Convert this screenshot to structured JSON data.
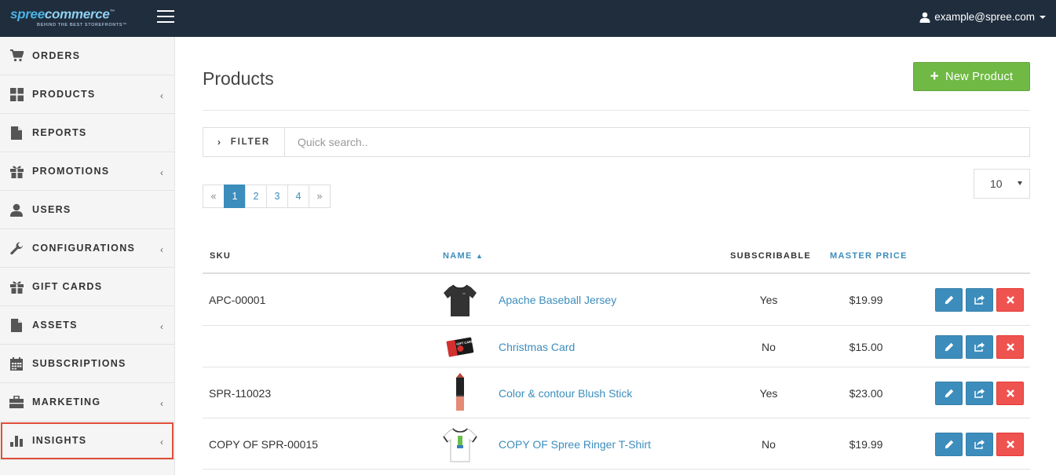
{
  "app": {
    "logo_main_a": "spree",
    "logo_main_b": "commerce",
    "logo_tm": "™",
    "logo_tagline": "BEHIND THE BEST STOREFRONTS™",
    "user_email": "example@spree.com"
  },
  "sidebar": {
    "items": [
      {
        "label": "ORDERS",
        "icon": "cart-icon",
        "chevron": false
      },
      {
        "label": "PRODUCTS",
        "icon": "grid-icon",
        "chevron": true
      },
      {
        "label": "REPORTS",
        "icon": "file-icon",
        "chevron": false
      },
      {
        "label": "PROMOTIONS",
        "icon": "gift-icon",
        "chevron": true
      },
      {
        "label": "USERS",
        "icon": "user-icon",
        "chevron": false
      },
      {
        "label": "CONFIGURATIONS",
        "icon": "wrench-icon",
        "chevron": true
      },
      {
        "label": "GIFT CARDS",
        "icon": "gift-icon",
        "chevron": false
      },
      {
        "label": "ASSETS",
        "icon": "file-icon",
        "chevron": true
      },
      {
        "label": "SUBSCRIPTIONS",
        "icon": "calendar-icon",
        "chevron": false
      },
      {
        "label": "MARKETING",
        "icon": "briefcase-icon",
        "chevron": true
      },
      {
        "label": "INSIGHTS",
        "icon": "bar-chart-icon",
        "chevron": true,
        "active": true
      }
    ],
    "chevron_glyph": "‹"
  },
  "page": {
    "title": "Products",
    "new_button_label": "New Product",
    "new_button_plus": "+",
    "filter_label": "FILTER",
    "filter_arrow": "›",
    "search_placeholder": "Quick search..",
    "per_page_value": "10"
  },
  "pagination": {
    "prev": "«",
    "pages": [
      "1",
      "2",
      "3",
      "4"
    ],
    "active_page": "1",
    "next": "»"
  },
  "table": {
    "headers": {
      "sku": "SKU",
      "name": "NAME",
      "name_sort": "▲",
      "subscribable": "SUBSCRIBABLE",
      "master_price": "MASTER PRICE"
    },
    "rows": [
      {
        "sku": "APC-00001",
        "name": "Apache Baseball Jersey",
        "subscribable": "Yes",
        "price": "$19.99",
        "thumb": "tshirt-dark"
      },
      {
        "sku": "",
        "name": "Christmas Card",
        "subscribable": "No",
        "price": "$15.00",
        "thumb": "gift-card",
        "thumb_text": "GIFT CARD"
      },
      {
        "sku": "SPR-110023",
        "name": "Color & contour Blush Stick",
        "subscribable": "Yes",
        "price": "$23.00",
        "thumb": "blush-stick"
      },
      {
        "sku": "COPY OF SPR-00015",
        "name": "COPY OF Spree Ringer T-Shirt",
        "subscribable": "No",
        "price": "$19.99",
        "thumb": "tshirt-white"
      }
    ]
  },
  "colors": {
    "topbar": "#1f2d3d",
    "accent": "#3c8dbc",
    "success": "#70b944",
    "danger": "#ef5350",
    "active_outline": "#e04e39"
  }
}
